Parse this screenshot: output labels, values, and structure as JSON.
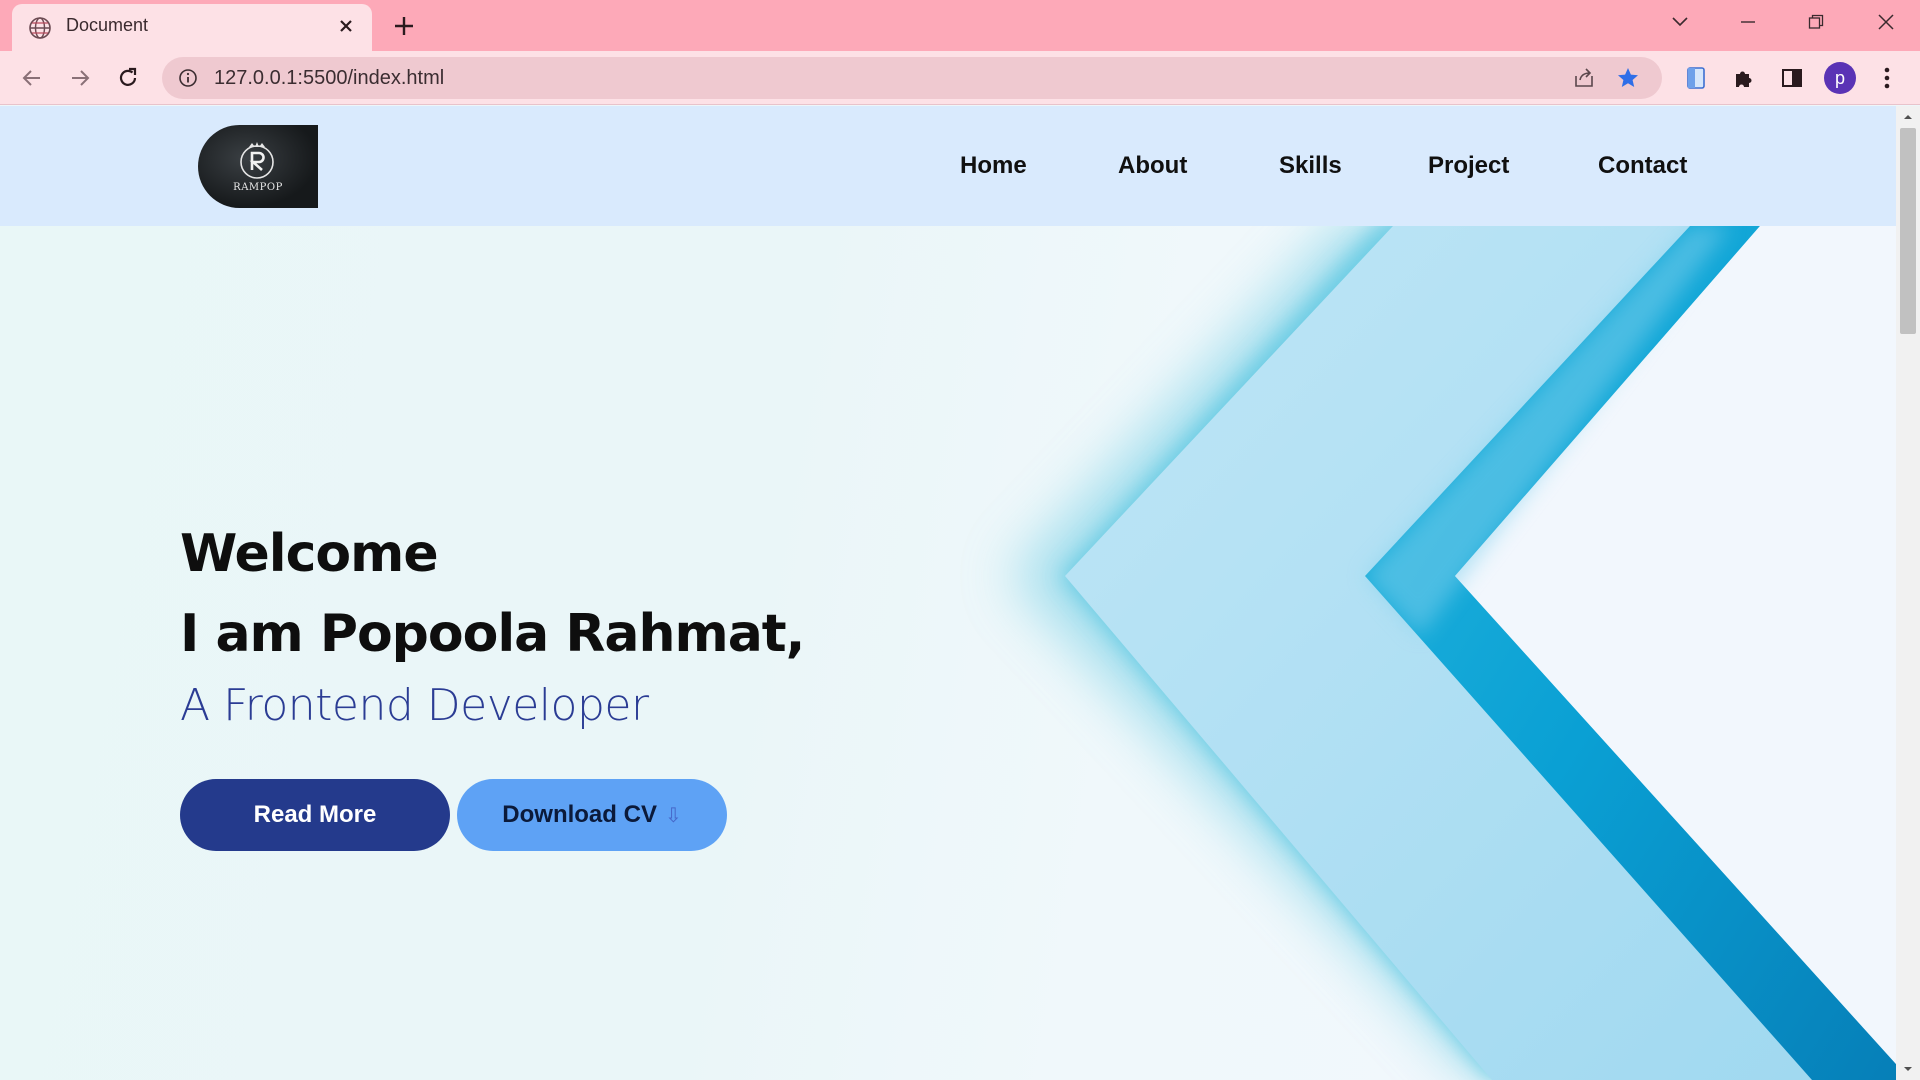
{
  "browser": {
    "tab_title": "Document",
    "url": "127.0.0.1:5500/index.html",
    "profile_initial": "p",
    "accent": "#5a33b5"
  },
  "site": {
    "logo_text": "RAMPOP",
    "nav": [
      "Home",
      "About",
      "Skills",
      "Project",
      "Contact"
    ]
  },
  "hero": {
    "welcome": "Welcome",
    "name_line": "I am Popoola Rahmat,",
    "role": "A Frontend Developer",
    "read_more": "Read More",
    "download_cv": "Download CV",
    "download_arrow": "⇩"
  },
  "colors": {
    "header_bg": "#d9eafd",
    "primary_button": "#243a8c",
    "secondary_button": "#5ea2f5",
    "role_text": "#2b3c94"
  }
}
